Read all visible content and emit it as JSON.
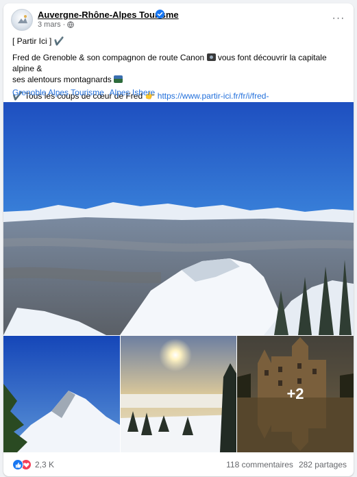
{
  "post": {
    "page_name": "Auvergne-Rhône-Alpes Tourisme",
    "date": "3 mars",
    "more_label": "···",
    "line1": "[ Partir Ici ] ✔️",
    "line2": "Fred de Grenoble & son compagnon de route Canon",
    "line2b": "vous font découvrir la capitale alpine &",
    "line3": "ses alentours montagnards",
    "line4_prefix": "✔️ Tous les coups de cœur de Fred",
    "url": "https://www.partir-ici.fr/fr/i/fred-",
    "hashtags": [
      "Grenoble Alpes Tourisme",
      "Alpes Ishere"
    ]
  },
  "media": {
    "main_alt": "Vue panoramique enneigée sur Grenoble",
    "thumbs": [
      "crête enneigée",
      "soleil sur la mer de nuages",
      "château"
    ],
    "more_count": "+2"
  },
  "footer": {
    "reaction_count": "2,3 K",
    "comments": "118 commentaires",
    "shares": "282 partages"
  },
  "icons": {
    "verified": "verified-badge-icon",
    "globe": "globe-icon",
    "like": "like-icon",
    "love": "love-icon"
  },
  "colors": {
    "accent": "#1877f2",
    "link": "#216fdb",
    "love": "#f33e58"
  }
}
